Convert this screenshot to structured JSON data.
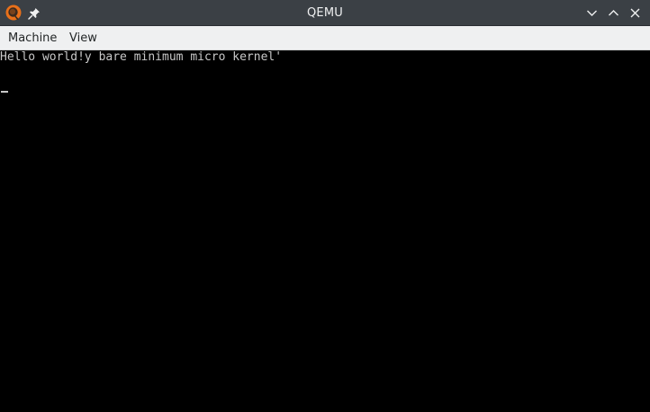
{
  "window": {
    "title": "QEMU"
  },
  "icons": {
    "app": "qemu-logo-icon",
    "pin": "pin-icon",
    "minimize": "chevron-down-icon",
    "maximize": "chevron-up-icon",
    "close": "close-icon"
  },
  "menubar": {
    "items": [
      {
        "label": "Machine"
      },
      {
        "label": "View"
      }
    ]
  },
  "console": {
    "lines": [
      "Hello world!y bare minimum micro kernel'"
    ]
  },
  "colors": {
    "titlebar": "#3b4045",
    "menubar": "#eff0f1",
    "screen": "#000000",
    "console_text": "#c8c8c8",
    "logo_orange": "#e8701a"
  }
}
